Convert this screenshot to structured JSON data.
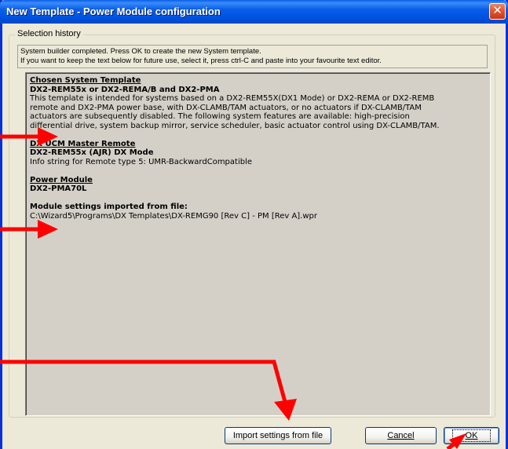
{
  "window": {
    "title": "New Template - Power Module configuration",
    "close_label": "✕"
  },
  "group": {
    "label": "Selection history"
  },
  "info": {
    "line1": "System builder completed. Press OK to create the new System template.",
    "line2": "If you want to keep the text below for future use, select it, press ctrl-C and paste into your favourite text editor."
  },
  "history": {
    "chosen": {
      "title": "Chosen System Template",
      "name": "DX2-REM55x or DX2-REMA/B and DX2-PMA",
      "desc1": "This template is intended for systems based on a DX2-REM55X(DX1 Mode) or DX2-REMA or DX2-REMB",
      "desc2": "remote and DX2-PMA power base, with DX-CLAMB/TAM actuators, or no actuators if DX-CLAMB/TAM",
      "desc3": "actuators are subsequently disabled. The following system features are available: high-precision",
      "desc4": "differential drive, system backup mirror, service scheduler, basic actuator control using DX-CLAMB/TAM."
    },
    "master": {
      "title": "DX UCM Master Remote",
      "name": "DX2-REM55x (AJR) DX Mode",
      "info": "Info string for Remote type 5: UMR-BackwardCompatible"
    },
    "power": {
      "title": "Power Module",
      "name": "DX2-PMA70L"
    },
    "module": {
      "title": "Module settings imported from file:",
      "path": "C:\\Wizard5\\Programs\\DX Templates\\DX-REMG90 [Rev C] - PM [Rev A].wpr"
    }
  },
  "buttons": {
    "import_label": "Import settings from file",
    "cancel_label": "Cancel",
    "ok_label": "OK"
  },
  "colors": {
    "titlebar": "#0054e3",
    "dialog_bg": "#ece9d8",
    "text_area_bg": "#d4d0c8",
    "annotation_arrow": "#ff0000"
  }
}
